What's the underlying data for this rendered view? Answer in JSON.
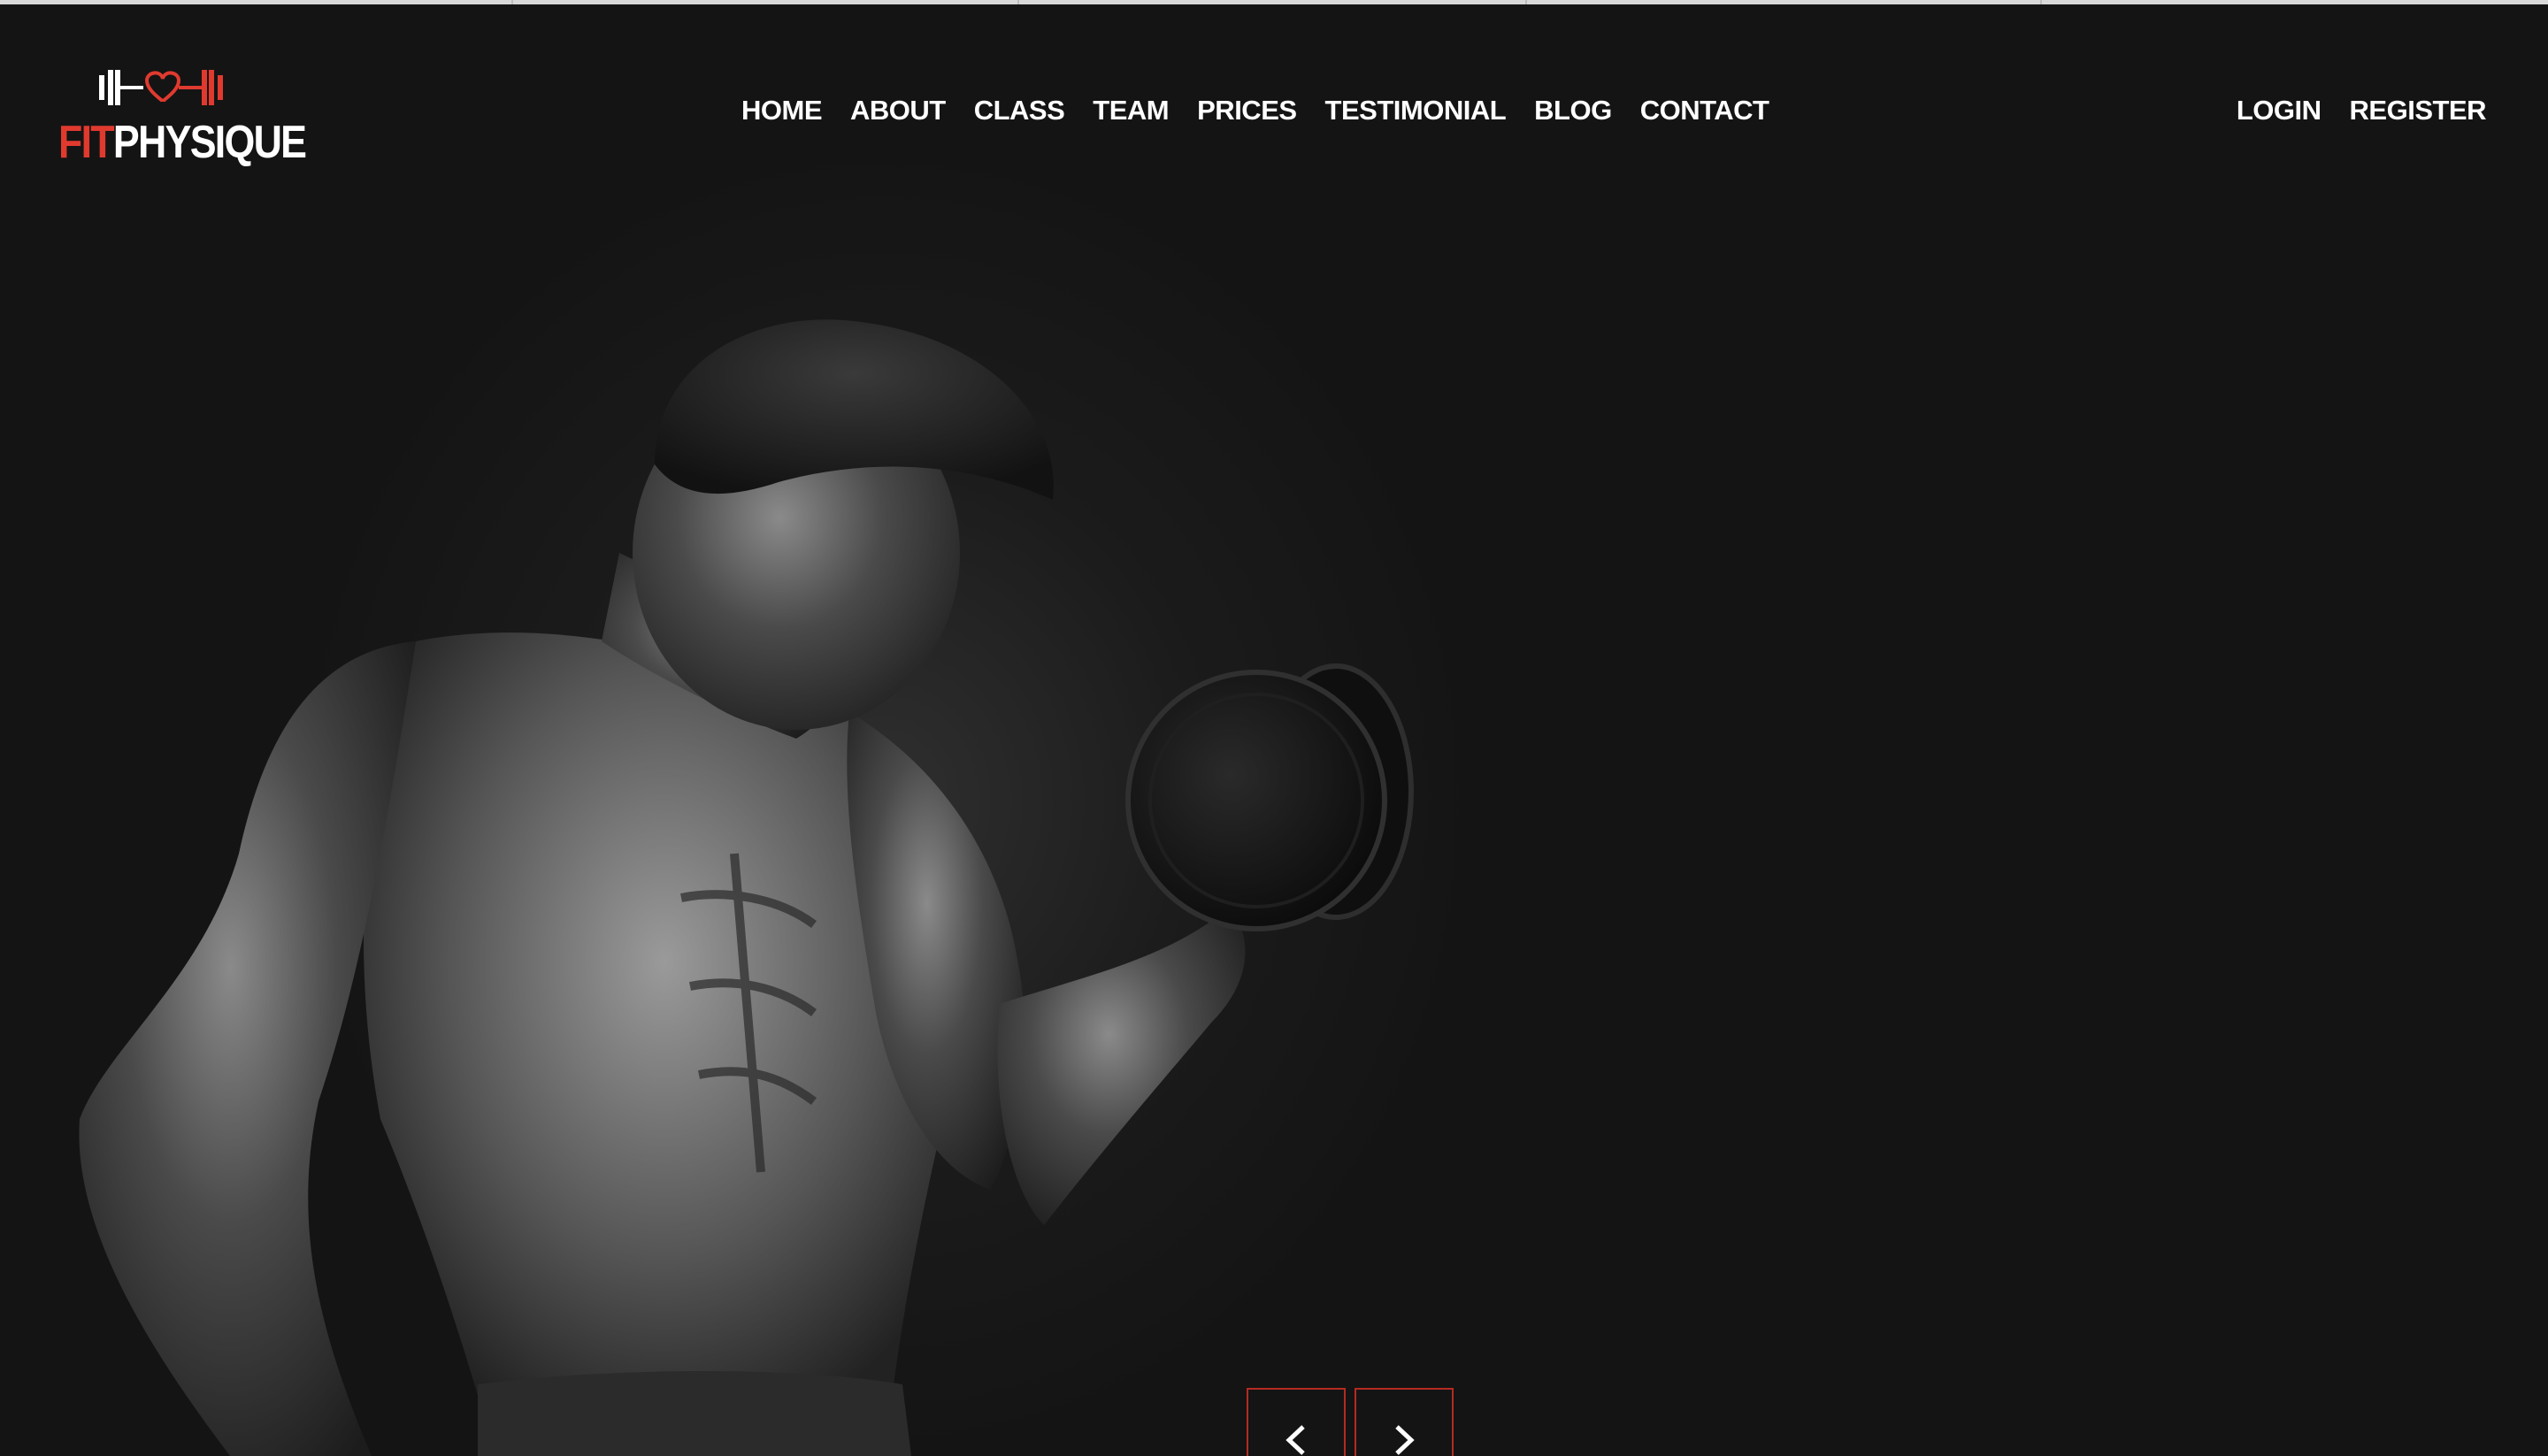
{
  "brand": {
    "name_first": "FIT",
    "name_second": "PHYSIQUE",
    "accent_color": "#e03a2f",
    "logo_icon": "dumbbell-heart-icon"
  },
  "nav": {
    "items": [
      {
        "label": "HOME"
      },
      {
        "label": "ABOUT"
      },
      {
        "label": "CLASS"
      },
      {
        "label": "TEAM"
      },
      {
        "label": "PRICES"
      },
      {
        "label": "TESTIMONIAL"
      },
      {
        "label": "BLOG"
      },
      {
        "label": "CONTACT"
      }
    ]
  },
  "auth": {
    "login_label": "LOGIN",
    "register_label": "REGISTER"
  },
  "hero": {
    "image": "bodybuilder-dumbbell-curl-photo",
    "prev_icon": "chevron-left-icon",
    "next_icon": "chevron-right-icon",
    "arrow_border_color": "#b52a22"
  }
}
